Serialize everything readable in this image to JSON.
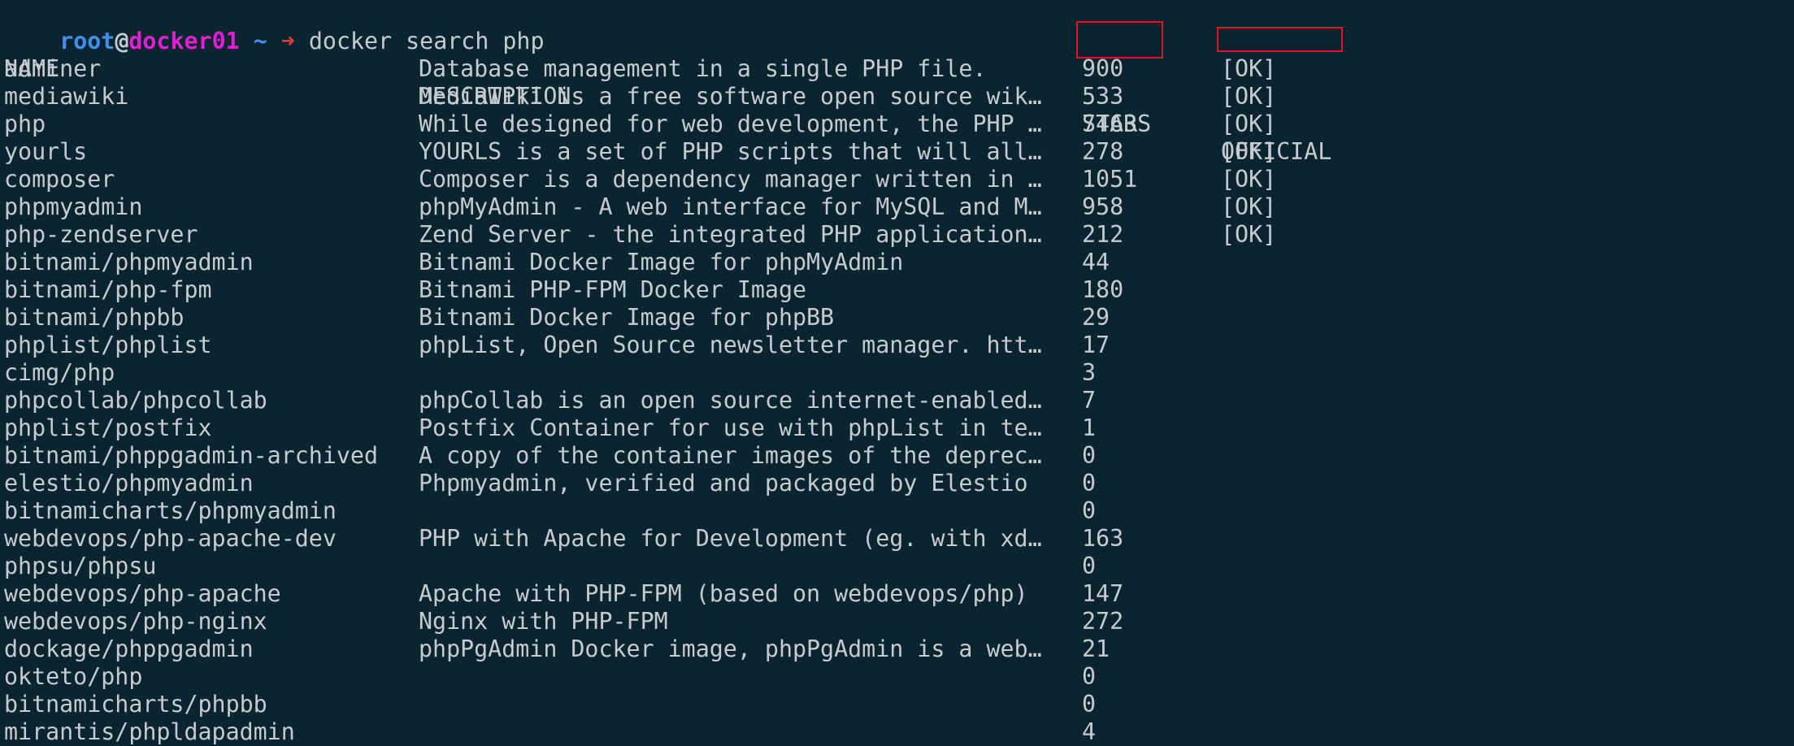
{
  "prompt": {
    "user": "root",
    "at": "@",
    "host": "docker01",
    "cwd": "~",
    "arrow": "➜",
    "command": "docker search php"
  },
  "table": {
    "headers": {
      "name": "NAME",
      "description": "DESCRIPTION",
      "stars": "STARS",
      "official": "OFFICIAL"
    },
    "rows": [
      {
        "name": "adminer",
        "description": "Database management in a single PHP file.",
        "stars": "900",
        "official": "[OK]"
      },
      {
        "name": "mediawiki",
        "description": "MediaWiki is a free software open source wik…",
        "stars": "533",
        "official": "[OK]"
      },
      {
        "name": "php",
        "description": "While designed for web development, the PHP …",
        "stars": "7463",
        "official": "[OK]"
      },
      {
        "name": "yourls",
        "description": "YOURLS is a set of PHP scripts that will all…",
        "stars": "278",
        "official": "[OK]"
      },
      {
        "name": "composer",
        "description": "Composer is a dependency manager written in …",
        "stars": "1051",
        "official": "[OK]"
      },
      {
        "name": "phpmyadmin",
        "description": "phpMyAdmin - A web interface for MySQL and M…",
        "stars": "958",
        "official": "[OK]"
      },
      {
        "name": "php-zendserver",
        "description": "Zend Server - the integrated PHP application…",
        "stars": "212",
        "official": "[OK]"
      },
      {
        "name": "bitnami/phpmyadmin",
        "description": "Bitnami Docker Image for phpMyAdmin",
        "stars": "44",
        "official": ""
      },
      {
        "name": "bitnami/php-fpm",
        "description": "Bitnami PHP-FPM Docker Image",
        "stars": "180",
        "official": ""
      },
      {
        "name": "bitnami/phpbb",
        "description": "Bitnami Docker Image for phpBB",
        "stars": "29",
        "official": ""
      },
      {
        "name": "phplist/phplist",
        "description": "phpList, Open Source newsletter manager. htt…",
        "stars": "17",
        "official": ""
      },
      {
        "name": "cimg/php",
        "description": "",
        "stars": "3",
        "official": ""
      },
      {
        "name": "phpcollab/phpcollab",
        "description": "phpCollab is an open source internet-enabled…",
        "stars": "7",
        "official": ""
      },
      {
        "name": "phplist/postfix",
        "description": "Postfix Container for use with phpList in te…",
        "stars": "1",
        "official": ""
      },
      {
        "name": "bitnami/phppgadmin-archived",
        "description": "A copy of the container images of the deprec…",
        "stars": "0",
        "official": ""
      },
      {
        "name": "elestio/phpmyadmin",
        "description": "Phpmyadmin, verified and packaged by Elestio",
        "stars": "0",
        "official": ""
      },
      {
        "name": "bitnamicharts/phpmyadmin",
        "description": "",
        "stars": "0",
        "official": ""
      },
      {
        "name": "webdevops/php-apache-dev",
        "description": "PHP with Apache for Development (eg. with xd…",
        "stars": "163",
        "official": ""
      },
      {
        "name": "phpsu/phpsu",
        "description": "",
        "stars": "0",
        "official": ""
      },
      {
        "name": "webdevops/php-apache",
        "description": "Apache with PHP-FPM (based on webdevops/php)",
        "stars": "147",
        "official": ""
      },
      {
        "name": "webdevops/php-nginx",
        "description": "Nginx with PHP-FPM",
        "stars": "272",
        "official": ""
      },
      {
        "name": "dockage/phppgadmin",
        "description": "phpPgAdmin Docker image, phpPgAdmin is a web…",
        "stars": "21",
        "official": ""
      },
      {
        "name": "okteto/php",
        "description": "",
        "stars": "0",
        "official": ""
      },
      {
        "name": "bitnamicharts/phpbb",
        "description": "",
        "stars": "0",
        "official": ""
      },
      {
        "name": "mirantis/phpldapadmin",
        "description": "",
        "stars": "4",
        "official": ""
      }
    ]
  },
  "colors": {
    "background": "#0b2530",
    "foreground": "#c5cbce",
    "user": "#3f8ef0",
    "host": "#e020d0",
    "arrow": "#e53935",
    "highlight_box": "#e8131c"
  }
}
